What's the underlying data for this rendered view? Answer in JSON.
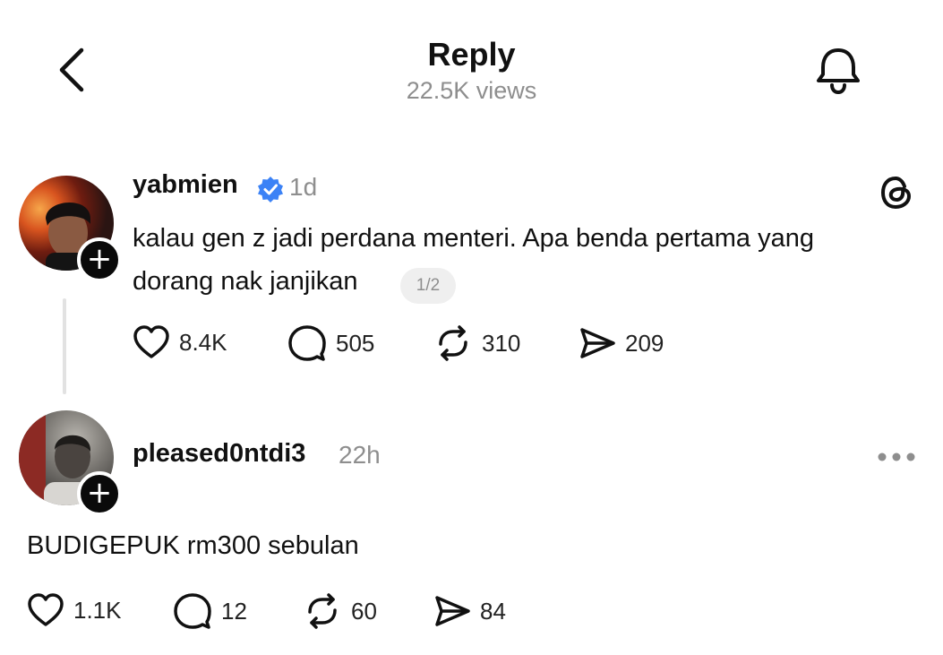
{
  "header": {
    "title": "Reply",
    "views": "22.5K views"
  },
  "post": {
    "username": "yabmien",
    "verified": true,
    "time": "1d",
    "text_line1": "kalau gen z jadi perdana menteri. Apa benda pertama yang",
    "text_line2": "dorang nak janjikan",
    "page_indicator": "1/2",
    "likes": "8.4K",
    "replies": "505",
    "reposts": "310",
    "shares": "209"
  },
  "reply": {
    "username": "pleased0ntdi3",
    "time": "22h",
    "text": "BUDIGEPUK rm300 sebulan",
    "likes": "1.1K",
    "replies": "12",
    "reposts": "60",
    "shares": "84"
  },
  "icons": {
    "back": "chevron-left-icon",
    "notifications": "bell-icon",
    "app": "threads-logo-icon",
    "like": "heart-icon",
    "reply": "comment-icon",
    "repost": "repost-icon",
    "share": "send-icon",
    "follow": "plus-icon",
    "more": "more-horizontal-icon",
    "verified": "verified-badge-icon"
  },
  "colors": {
    "verified": "#3b82f6",
    "muted_text": "#8e8e8e",
    "primary_text": "#111111"
  }
}
